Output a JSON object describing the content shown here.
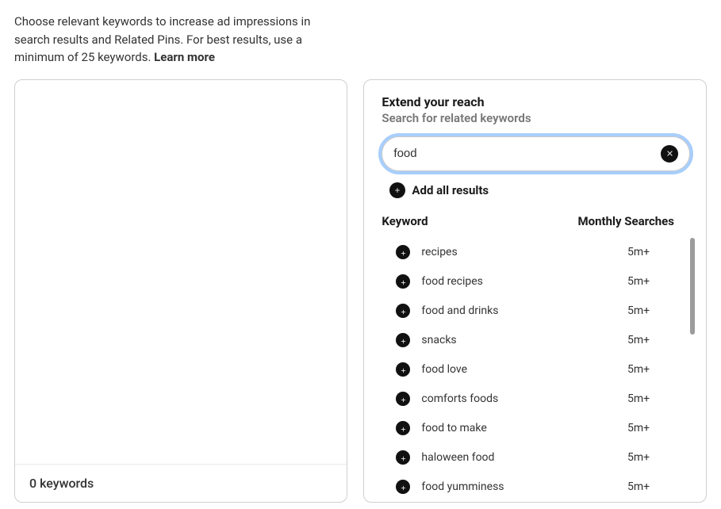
{
  "instruction": {
    "text_prefix": "Choose relevant keywords to increase ad impressions in search results and Related Pins. For best results, use a minimum of 25 keywords. ",
    "learn_more": "Learn more"
  },
  "left_panel": {
    "footer": "0 keywords"
  },
  "right_panel": {
    "title": "Extend your reach",
    "subtitle": "Search for related keywords",
    "search_value": "food",
    "add_all_label": "Add all results",
    "header_keyword": "Keyword",
    "header_searches": "Monthly Searches",
    "results": [
      {
        "keyword": "recipes",
        "searches": "5m+"
      },
      {
        "keyword": "food recipes",
        "searches": "5m+"
      },
      {
        "keyword": "food and drinks",
        "searches": "5m+"
      },
      {
        "keyword": "snacks",
        "searches": "5m+"
      },
      {
        "keyword": "food love",
        "searches": "5m+"
      },
      {
        "keyword": "comforts foods",
        "searches": "5m+"
      },
      {
        "keyword": "food to make",
        "searches": "5m+"
      },
      {
        "keyword": "haloween food",
        "searches": "5m+"
      },
      {
        "keyword": "food yumminess",
        "searches": "5m+"
      }
    ]
  }
}
